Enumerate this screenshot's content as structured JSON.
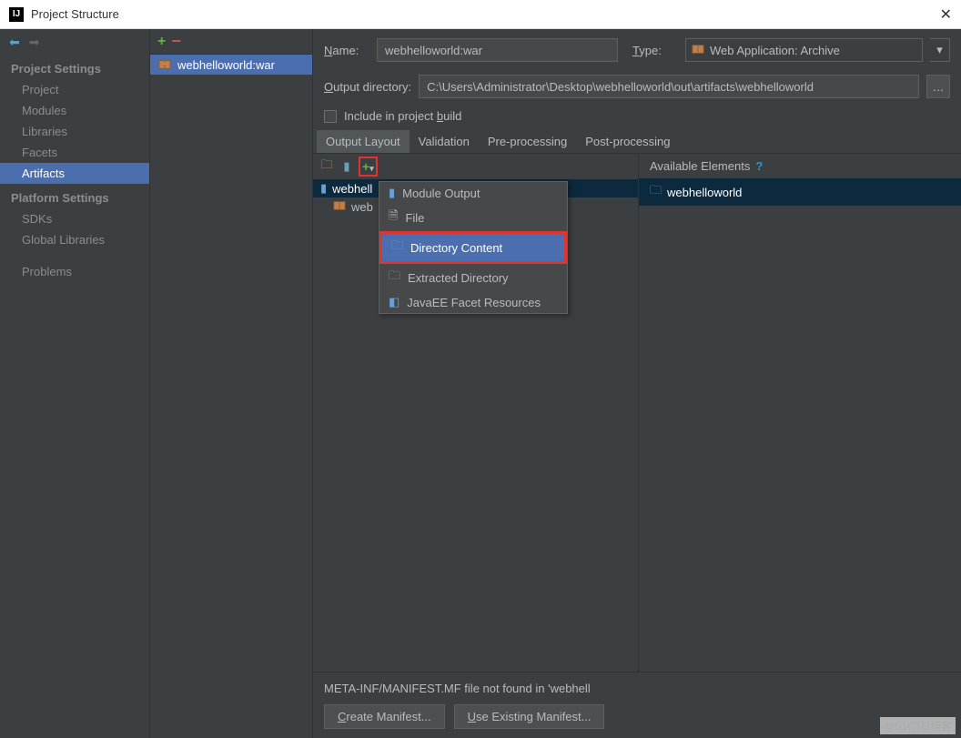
{
  "window": {
    "title": "Project Structure"
  },
  "sidebar": {
    "project_settings_header": "Project Settings",
    "project": "Project",
    "modules": "Modules",
    "libraries": "Libraries",
    "facets": "Facets",
    "artifacts": "Artifacts",
    "platform_settings_header": "Platform Settings",
    "sdks": "SDKs",
    "global_libraries": "Global Libraries",
    "problems": "Problems"
  },
  "artifacts_list": {
    "item0": "webhelloworld:war"
  },
  "form": {
    "name_label": "Name:",
    "name_value": "webhelloworld:war",
    "type_label": "Type:",
    "type_value": "Web Application: Archive",
    "output_dir_label": "Output directory:",
    "output_dir_value": "C:\\Users\\Administrator\\Desktop\\webhelloworld\\out\\artifacts\\webhelloworld",
    "include_build": "Include in project build"
  },
  "tabs": {
    "output_layout": "Output Layout",
    "validation": "Validation",
    "preprocessing": "Pre-processing",
    "postprocessing": "Post-processing"
  },
  "tree": {
    "root": "webhell",
    "child": "web"
  },
  "available": {
    "header": "Available Elements",
    "item0": "webhelloworld"
  },
  "popup": {
    "module_output": "Module Output",
    "file": "File",
    "directory_content": "Directory Content",
    "extracted_directory": "Extracted Directory",
    "javaee_facet": "JavaEE Facet Resources"
  },
  "bottom": {
    "info": "META-INF/MANIFEST.MF file not found in 'webhell",
    "create_manifest": "Create Manifest...",
    "use_existing": "Use Existing Manifest..."
  },
  "watermark": "@51CTO博客"
}
